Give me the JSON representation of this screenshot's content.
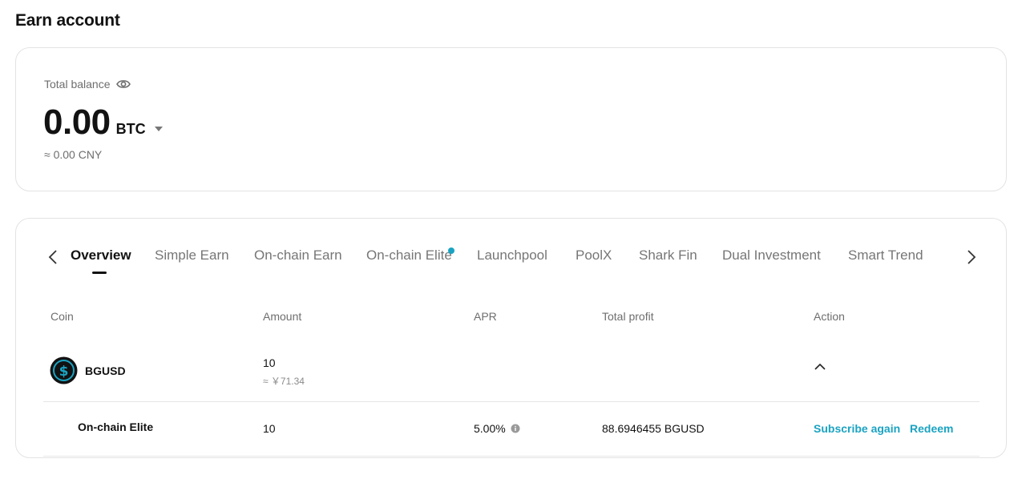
{
  "page": {
    "title": "Earn account"
  },
  "balance": {
    "label": "Total balance",
    "value": "0.00",
    "unit": "BTC",
    "fiat": "≈ 0.00 CNY"
  },
  "tabs": [
    {
      "label": "Overview",
      "active": true
    },
    {
      "label": "Simple Earn"
    },
    {
      "label": "On-chain Earn"
    },
    {
      "label": "On-chain Elite",
      "badge_dot": true
    },
    {
      "label": "Launchpool"
    },
    {
      "label": "PoolX"
    },
    {
      "label": "Shark Fin"
    },
    {
      "label": "Dual Investment"
    },
    {
      "label": "Smart Trend"
    }
  ],
  "table": {
    "headers": [
      "Coin",
      "Amount",
      "APR",
      "Total profit",
      "Action"
    ],
    "asset_row": {
      "coin": "BGUSD",
      "amount": "10",
      "amount_fiat": "≈ ￥71.34"
    },
    "sub_row": {
      "product": "On-chain Elite",
      "amount": "10",
      "apr": "5.00%",
      "total_profit": "88.6946455 BGUSD",
      "actions": [
        "Subscribe again",
        "Redeem"
      ]
    }
  },
  "colors": {
    "accent": "#1aa3c2",
    "text_primary": "#121212",
    "text_secondary": "#6e6e6e",
    "border": "#e3e3e3"
  },
  "icons": {
    "visibility": "eye-icon",
    "unit_selector": "caret-down-icon",
    "prev": "chevron-left-icon",
    "next": "chevron-right-icon",
    "row_toggle": "chevron-up-icon",
    "apr_help": "info-icon",
    "coin": "dollar-coin-icon"
  }
}
